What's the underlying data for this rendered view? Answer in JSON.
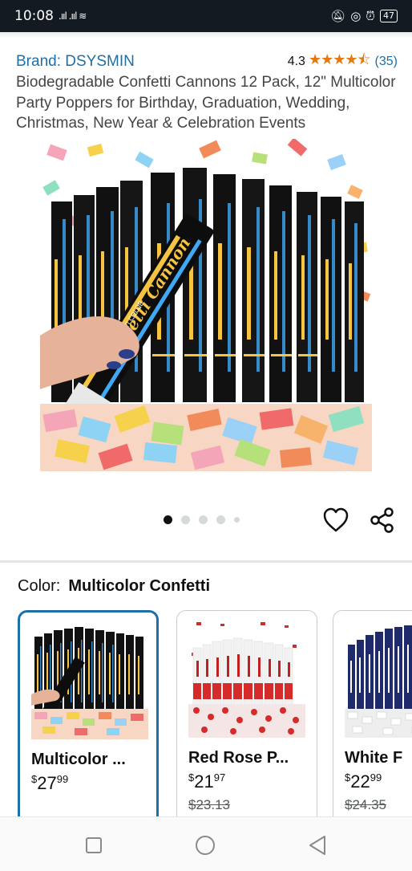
{
  "status_bar": {
    "time": "10:08",
    "battery": "47"
  },
  "product": {
    "brand": "Brand: DSYSMIN",
    "rating": "4.3",
    "rating_count": "(35)",
    "title": "Biodegradable Confetti Cannons 12 Pack, 12\" Multicolor Party Poppers for Birthday, Graduation, Wedding, Christmas, New Year & Celebration Events"
  },
  "gallery": {
    "image_count": 5,
    "active_index": 0,
    "cannon_text": "Confetti Cannon",
    "cannon_sub": "MULTI COLOR"
  },
  "color": {
    "label": "Color:",
    "selected": "Multicolor Confetti",
    "options": [
      {
        "name": "Multicolor ...",
        "price_symbol": "$",
        "price_whole": "27",
        "price_fraction": "99",
        "list_price": ""
      },
      {
        "name": "Red Rose P...",
        "price_symbol": "$",
        "price_whole": "21",
        "price_fraction": "97",
        "list_price": "$23.13"
      },
      {
        "name": "White F",
        "price_symbol": "$",
        "price_whole": "22",
        "price_fraction": "99",
        "list_price": "$24.35"
      }
    ]
  },
  "colors": {
    "link": "#1e6fa8",
    "star": "#e47911",
    "selected_border": "#1e6fa8",
    "status_bar": "#131a22"
  }
}
